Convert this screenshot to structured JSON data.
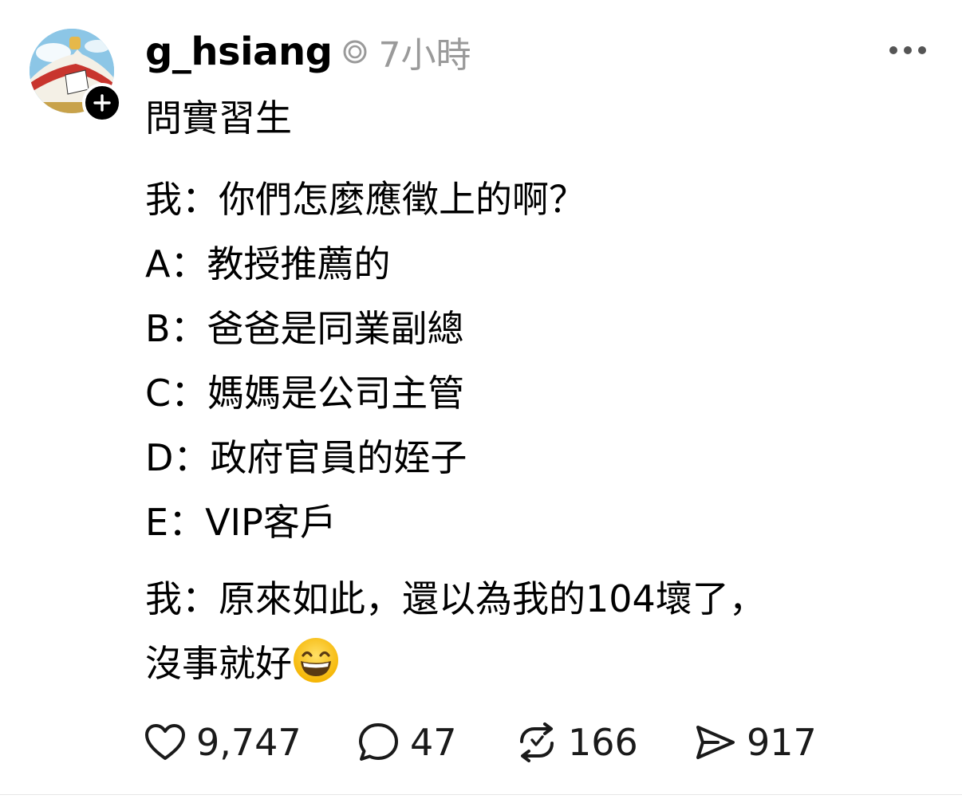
{
  "post": {
    "username": "g_hsiang",
    "timestamp": "7小時",
    "title": "問實習生",
    "question": "我：你們怎麼應徵上的啊？",
    "answers": [
      "A：教授推薦的",
      "B：爸爸是同業副總",
      "C：媽媽是公司主管",
      "D：政府官員的姪子",
      "E：VIP客戶"
    ],
    "closing_line1": "我：原來如此，還以為我的104壞了，",
    "closing_line2": "沒事就好",
    "emoji": "grinning-face-with-smiling-eyes"
  },
  "actions": {
    "likes": "9,747",
    "replies": "47",
    "reposts": "166",
    "shares": "917"
  },
  "colors": {
    "text": "#000000",
    "muted": "#9a9a9a",
    "badge": "#000000"
  },
  "icons": {
    "like": "heart-icon",
    "reply": "comment-bubble-icon",
    "repost": "repost-arrows-icon",
    "share": "send-icon",
    "more": "more-dots-icon",
    "follow": "plus-icon"
  }
}
